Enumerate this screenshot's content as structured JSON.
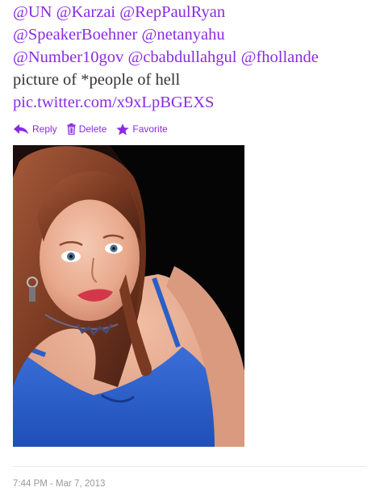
{
  "tweet": {
    "lines": [
      [
        "@UN",
        "@Karzai",
        "@RepPaulRyan"
      ],
      [
        "@SpeakerBoehner",
        "@netanyahu"
      ],
      [
        "@Number10gov",
        "@cbabdullahgul",
        "@fhollande"
      ]
    ],
    "text": "picture of *people of hell",
    "link": "pic.twitter.com/x9xLpBGEXS"
  },
  "actions": {
    "reply": "Reply",
    "delete": "Delete",
    "favorite": "Favorite"
  },
  "timestamp": "7:44 PM - Mar 7, 2013",
  "colors": {
    "link": "#8a2be2",
    "text": "#333333",
    "muted": "#999999"
  },
  "photo_icon": "photo-of-woman-in-blue-top"
}
